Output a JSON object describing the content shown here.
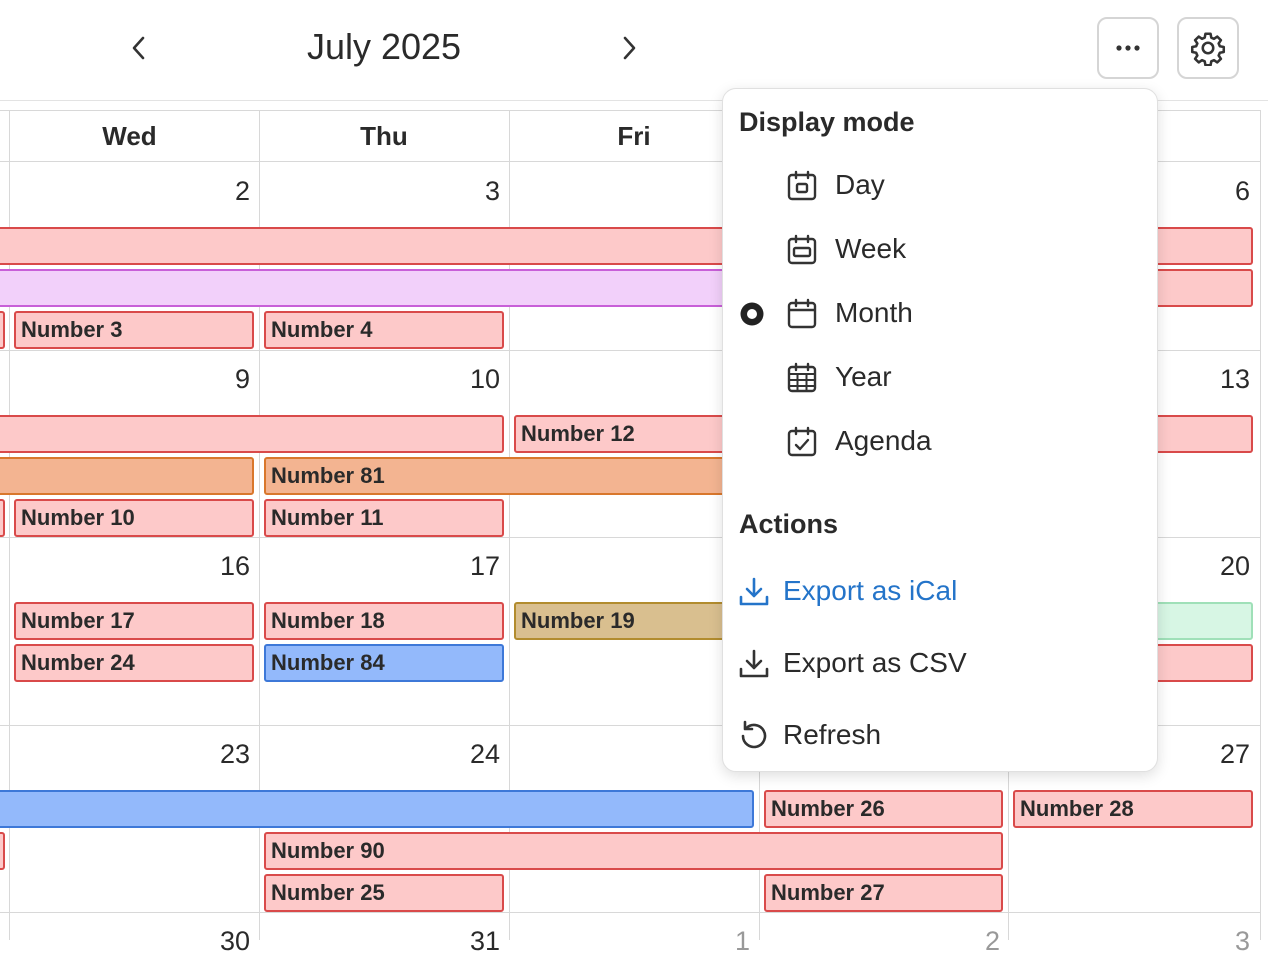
{
  "header": {
    "title": "July 2025",
    "prev_icon": "chevron-left-icon",
    "next_icon": "chevron-right-icon",
    "more_icon": "ellipsis-icon",
    "settings_icon": "gear-icon"
  },
  "weekdays": [
    "Wed",
    "Thu",
    "Fri"
  ],
  "weeks": [
    {
      "days": [
        "2",
        "3",
        "6"
      ]
    },
    {
      "days": [
        "9",
        "10",
        "13"
      ]
    },
    {
      "days": [
        "16",
        "17",
        "20"
      ]
    },
    {
      "days": [
        "23",
        "24",
        "27"
      ]
    },
    {
      "days": [
        "30",
        "31",
        "1",
        "2",
        "3"
      ]
    }
  ],
  "events": {
    "n3": "Number 3",
    "n4": "Number 4",
    "n12": "Number 12",
    "n81": "Number 81",
    "n10": "Number 10",
    "n11": "Number 11",
    "n17": "Number 17",
    "n18": "Number 18",
    "n19": "Number 19",
    "n24": "Number 24",
    "n84": "Number 84",
    "n26": "Number 26",
    "n28": "Number 28",
    "n90": "Number 90",
    "n25": "Number 25",
    "n27": "Number 27"
  },
  "menu": {
    "display_heading": "Display mode",
    "modes": [
      {
        "label": "Day",
        "icon": "calendar-day-icon",
        "selected": false
      },
      {
        "label": "Week",
        "icon": "calendar-week-icon",
        "selected": false
      },
      {
        "label": "Month",
        "icon": "calendar-month-icon",
        "selected": true
      },
      {
        "label": "Year",
        "icon": "calendar-year-icon",
        "selected": false
      },
      {
        "label": "Agenda",
        "icon": "calendar-agenda-icon",
        "selected": false
      }
    ],
    "actions_heading": "Actions",
    "actions": [
      {
        "label": "Export as iCal",
        "icon": "download-icon"
      },
      {
        "label": "Export as CSV",
        "icon": "download-icon"
      },
      {
        "label": "Refresh",
        "icon": "refresh-icon"
      }
    ]
  },
  "colors": {
    "accent": "#2474c9",
    "event_red": "#fdc9c9",
    "event_purple": "#f2d0fa",
    "event_orange": "#f3b491",
    "event_tan": "#d9bf8f",
    "event_blue": "#93b9fb",
    "event_green": "#d7f6e4"
  }
}
